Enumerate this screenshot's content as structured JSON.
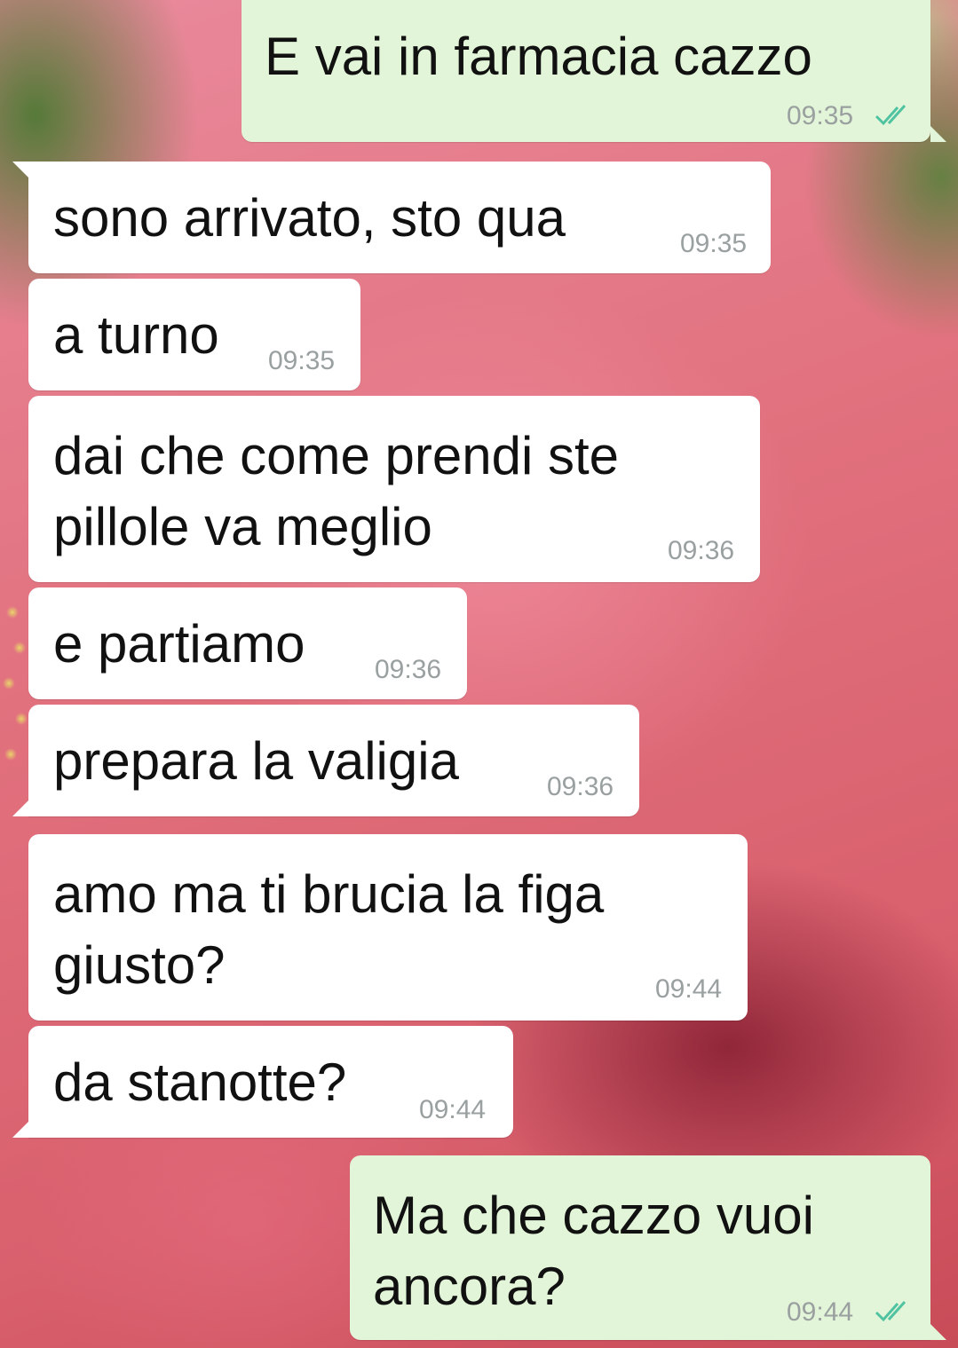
{
  "colors": {
    "incoming_bubble": "#ffffff",
    "outgoing_bubble": "#e3f5d8",
    "read_ticks": "#4fc3a1",
    "timestamp": "#9aa0a0"
  },
  "messages": [
    {
      "direction": "outgoing",
      "text": "E vai in farmacia cazzo",
      "time": "09:35",
      "status_icon": "double-check-icon"
    },
    {
      "direction": "incoming",
      "text": "sono arrivato, sto qua",
      "time": "09:35"
    },
    {
      "direction": "incoming",
      "text": "a turno",
      "time": "09:35"
    },
    {
      "direction": "incoming",
      "text_line1": "dai che come prendi ste",
      "text_line2": "pillole va meglio",
      "time": "09:36"
    },
    {
      "direction": "incoming",
      "text": "e partiamo",
      "time": "09:36"
    },
    {
      "direction": "incoming",
      "text": "prepara la valigia",
      "time": "09:36"
    },
    {
      "direction": "incoming",
      "text_line1": "amo ma ti brucia la figa",
      "text_line2": "giusto?",
      "time": "09:44"
    },
    {
      "direction": "incoming",
      "text": "da stanotte?",
      "time": "09:44"
    },
    {
      "direction": "outgoing",
      "text_line1": "Ma che cazzo vuoi",
      "text_line2": "ancora?",
      "time": "09:44",
      "status_icon": "double-check-icon"
    }
  ]
}
